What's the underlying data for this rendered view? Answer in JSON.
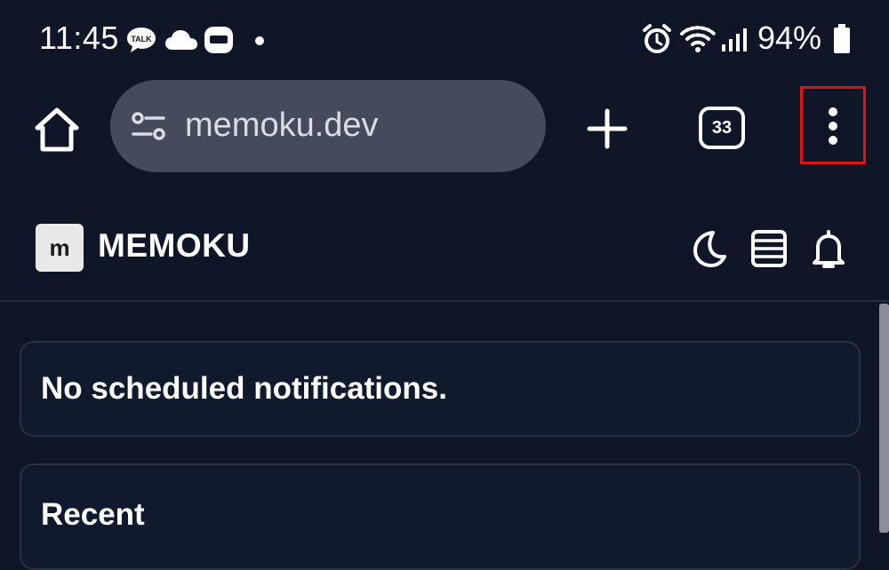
{
  "status_bar": {
    "time": "11:45",
    "battery_percent": "94%",
    "icons": [
      "chat-icon",
      "cloud-icon",
      "app-badge-icon",
      "notification-dot-icon",
      "alarm-icon",
      "wifi-icon",
      "signal-icon",
      "battery-icon"
    ]
  },
  "browser": {
    "url": "memoku.dev",
    "tab_count": "33",
    "icons": [
      "home-icon",
      "site-settings-icon",
      "plus-icon",
      "tab-switcher-icon",
      "more-vert-icon"
    ],
    "highlight_color": "#e01414"
  },
  "site": {
    "logo_letter": "m",
    "name": "MEMOKU",
    "header_icons": [
      "moon-icon",
      "list-icon",
      "bell-icon"
    ]
  },
  "content": {
    "notifications_message": "No scheduled notifications.",
    "recent_heading": "Recent"
  },
  "colors": {
    "background": "#0f1628",
    "url_bar": "#444b5c",
    "card_border": "#283044"
  }
}
